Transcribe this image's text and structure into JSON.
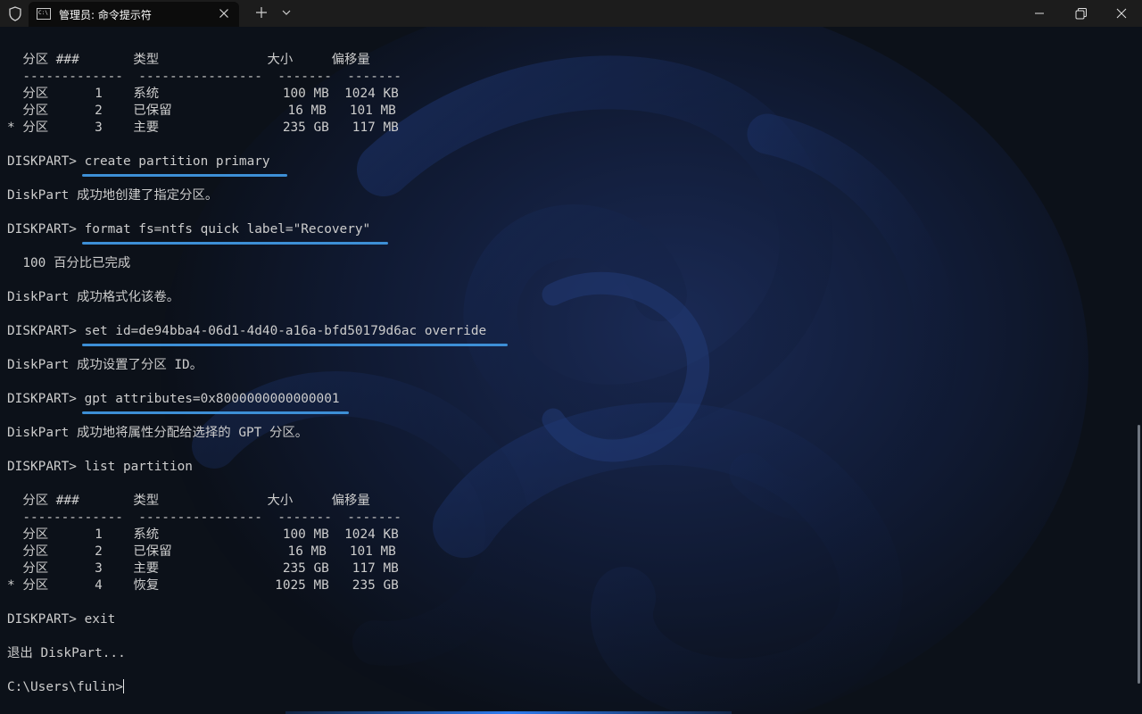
{
  "window": {
    "tab_title": "管理员: 命令提示符",
    "tab_icon_text": "C:\\"
  },
  "icons": {
    "shield": "shield-icon",
    "tab": "cmd-icon",
    "close_tab": "close-icon",
    "new_tab": "plus-icon",
    "dropdown": "chevron-down-icon",
    "minimize": "minimize-icon",
    "maximize": "restore-icon",
    "close": "close-icon"
  },
  "colors": {
    "underline": "#3d8fd6",
    "text": "#cccccc",
    "titlebar": "#1c1c1c"
  },
  "terminal": {
    "lines": [
      "  分区 ###       类型              大小     偏移量",
      "  -------------  ----------------  -------  -------",
      "  分区      1    系统                100 MB  1024 KB",
      "  分区      2    已保留               16 MB   101 MB",
      "* 分区      3    主要                235 GB   117 MB",
      "",
      "DISKPART> create partition primary",
      "",
      "DiskPart 成功地创建了指定分区。",
      "",
      "DISKPART> format fs=ntfs quick label=\"Recovery\"",
      "",
      "  100 百分比已完成",
      "",
      "DiskPart 成功格式化该卷。",
      "",
      "DISKPART> set id=de94bba4-06d1-4d40-a16a-bfd50179d6ac override",
      "",
      "DiskPart 成功设置了分区 ID。",
      "",
      "DISKPART> gpt attributes=0x8000000000000001",
      "",
      "DiskPart 成功地将属性分配给选择的 GPT 分区。",
      "",
      "DISKPART> list partition",
      "",
      "  分区 ###       类型              大小     偏移量",
      "  -------------  ----------------  -------  -------",
      "  分区      1    系统                100 MB  1024 KB",
      "  分区      2    已保留               16 MB   101 MB",
      "  分区      3    主要                235 GB   117 MB",
      "* 分区      4    恢复               1025 MB   235 GB",
      "",
      "DISKPART> exit",
      "",
      "退出 DiskPart...",
      "",
      "C:\\Users\\fulin>"
    ]
  }
}
